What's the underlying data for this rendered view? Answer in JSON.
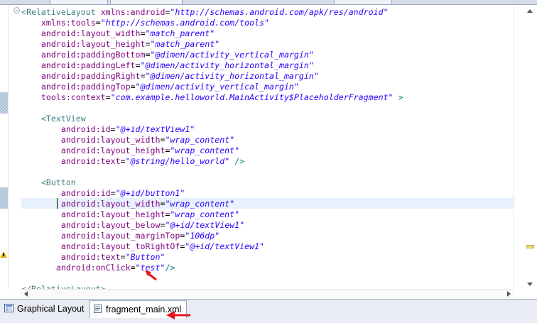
{
  "code_lines": [
    {
      "parts": [
        {
          "c": "tag",
          "t": "<RelativeLayout "
        },
        {
          "c": "attr",
          "t": "xmlns:android"
        },
        {
          "c": "eq",
          "t": "="
        },
        {
          "c": "str",
          "t": "\"http://schemas.android.com/apk/res/android\""
        }
      ]
    },
    {
      "parts": [
        {
          "c": "attr",
          "t": "    xmlns:tools"
        },
        {
          "c": "eq",
          "t": "="
        },
        {
          "c": "str",
          "t": "\"http://schemas.android.com/tools\""
        }
      ]
    },
    {
      "parts": [
        {
          "c": "attr",
          "t": "    android:layout_width"
        },
        {
          "c": "eq",
          "t": "="
        },
        {
          "c": "str",
          "t": "\"match_parent\""
        }
      ]
    },
    {
      "parts": [
        {
          "c": "attr",
          "t": "    android:layout_height"
        },
        {
          "c": "eq",
          "t": "="
        },
        {
          "c": "str",
          "t": "\"match_parent\""
        }
      ]
    },
    {
      "parts": [
        {
          "c": "attr",
          "t": "    android:paddingBottom"
        },
        {
          "c": "eq",
          "t": "="
        },
        {
          "c": "str",
          "t": "\"@dimen/activity_vertical_margin\""
        }
      ]
    },
    {
      "parts": [
        {
          "c": "attr",
          "t": "    android:paddingLeft"
        },
        {
          "c": "eq",
          "t": "="
        },
        {
          "c": "str",
          "t": "\"@dimen/activity_horizontal_margin\""
        }
      ]
    },
    {
      "parts": [
        {
          "c": "attr",
          "t": "    android:paddingRight"
        },
        {
          "c": "eq",
          "t": "="
        },
        {
          "c": "str",
          "t": "\"@dimen/activity_horizontal_margin\""
        }
      ]
    },
    {
      "parts": [
        {
          "c": "attr",
          "t": "    android:paddingTop"
        },
        {
          "c": "eq",
          "t": "="
        },
        {
          "c": "str",
          "t": "\"@dimen/activity_vertical_margin\""
        }
      ]
    },
    {
      "parts": [
        {
          "c": "attr",
          "t": "    tools:context"
        },
        {
          "c": "eq",
          "t": "="
        },
        {
          "c": "str",
          "t": "\"com.example.helloworld.MainActivity$PlaceholderFragment\""
        },
        {
          "c": "gt",
          "t": " >"
        }
      ]
    },
    {
      "parts": []
    },
    {
      "parts": [
        {
          "c": "tag",
          "t": "    <TextView"
        }
      ]
    },
    {
      "parts": [
        {
          "c": "attr",
          "t": "        android:id"
        },
        {
          "c": "eq",
          "t": "="
        },
        {
          "c": "str",
          "t": "\"@+id/textView1\""
        }
      ]
    },
    {
      "parts": [
        {
          "c": "attr",
          "t": "        android:layout_width"
        },
        {
          "c": "eq",
          "t": "="
        },
        {
          "c": "str",
          "t": "\"wrap_content\""
        }
      ]
    },
    {
      "parts": [
        {
          "c": "attr",
          "t": "        android:layout_height"
        },
        {
          "c": "eq",
          "t": "="
        },
        {
          "c": "str",
          "t": "\"wrap_content\""
        }
      ]
    },
    {
      "parts": [
        {
          "c": "attr",
          "t": "        android:text"
        },
        {
          "c": "eq",
          "t": "="
        },
        {
          "c": "str",
          "t": "\"@string/hello_world\""
        },
        {
          "c": "gt",
          "t": " />"
        }
      ]
    },
    {
      "parts": []
    },
    {
      "parts": [
        {
          "c": "tag",
          "t": "    <Button"
        }
      ]
    },
    {
      "parts": [
        {
          "c": "attr",
          "t": "        android:id"
        },
        {
          "c": "eq",
          "t": "="
        },
        {
          "c": "str",
          "t": "\"@+id/button1\""
        }
      ]
    },
    {
      "parts": [
        {
          "c": "attr",
          "t": "        android:layout_width"
        },
        {
          "c": "eq",
          "t": "="
        },
        {
          "c": "str",
          "t": "\"wrap_content\""
        }
      ]
    },
    {
      "parts": [
        {
          "c": "attr",
          "t": "        android:layout_height"
        },
        {
          "c": "eq",
          "t": "="
        },
        {
          "c": "str",
          "t": "\"wrap_content\""
        }
      ]
    },
    {
      "parts": [
        {
          "c": "attr",
          "t": "        android:layout_below"
        },
        {
          "c": "eq",
          "t": "="
        },
        {
          "c": "str",
          "t": "\"@+id/textView1\""
        }
      ]
    },
    {
      "parts": [
        {
          "c": "attr",
          "t": "        android:layout_marginTop"
        },
        {
          "c": "eq",
          "t": "="
        },
        {
          "c": "str",
          "t": "\"106dp\""
        }
      ]
    },
    {
      "parts": [
        {
          "c": "attr",
          "t": "        android:layout_toRightOf"
        },
        {
          "c": "eq",
          "t": "="
        },
        {
          "c": "str",
          "t": "\"@+id/textView1\""
        }
      ]
    },
    {
      "parts": [
        {
          "c": "attr",
          "t": "        android:text"
        },
        {
          "c": "eq",
          "t": "="
        },
        {
          "c": "str",
          "t": "\"Button\""
        }
      ]
    },
    {
      "parts": [
        {
          "c": "attr",
          "t": "       android:onClick"
        },
        {
          "c": "eq",
          "t": "="
        },
        {
          "c": "str",
          "t": "\"test\""
        },
        {
          "c": "gt",
          "t": "/>"
        }
      ]
    },
    {
      "parts": []
    },
    {
      "parts": [
        {
          "c": "tag",
          "t": "</RelativeLayout>"
        }
      ]
    }
  ],
  "tabs": {
    "graphical_layout": "Graphical Layout",
    "fragment_main": "fragment_main.xml"
  },
  "colors": {
    "accent_red": "#e8141b",
    "tag": "#3f7f7f",
    "attribute": "#7f007f",
    "string": "#2a00ff"
  }
}
